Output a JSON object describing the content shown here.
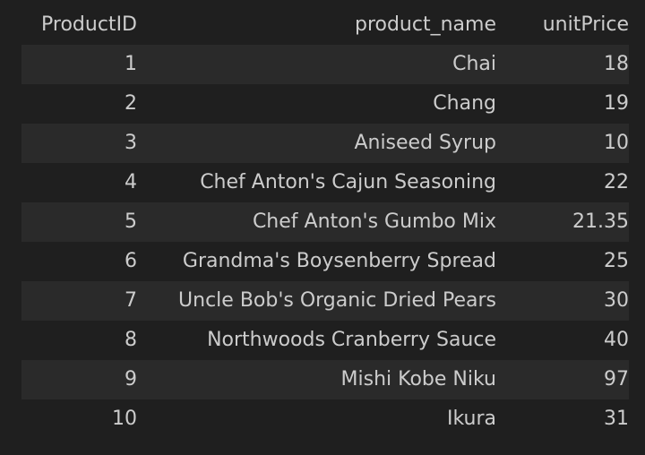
{
  "table": {
    "columns": [
      "ProductID",
      "product_name",
      "unitPrice"
    ],
    "rows": [
      [
        "1",
        "Chai",
        "18"
      ],
      [
        "2",
        "Chang",
        "19"
      ],
      [
        "3",
        "Aniseed Syrup",
        "10"
      ],
      [
        "4",
        "Chef Anton's Cajun Seasoning",
        "22"
      ],
      [
        "5",
        "Chef Anton's Gumbo Mix",
        "21.35"
      ],
      [
        "6",
        "Grandma's Boysenberry Spread",
        "25"
      ],
      [
        "7",
        "Uncle Bob's Organic Dried Pears",
        "30"
      ],
      [
        "8",
        "Northwoods Cranberry Sauce",
        "40"
      ],
      [
        "9",
        "Mishi Kobe Niku",
        "97"
      ],
      [
        "10",
        "Ikura",
        "31"
      ]
    ]
  },
  "colors": {
    "background": "#1f1f1f",
    "stripe": "#2a2a2a",
    "text": "#cccccc"
  }
}
